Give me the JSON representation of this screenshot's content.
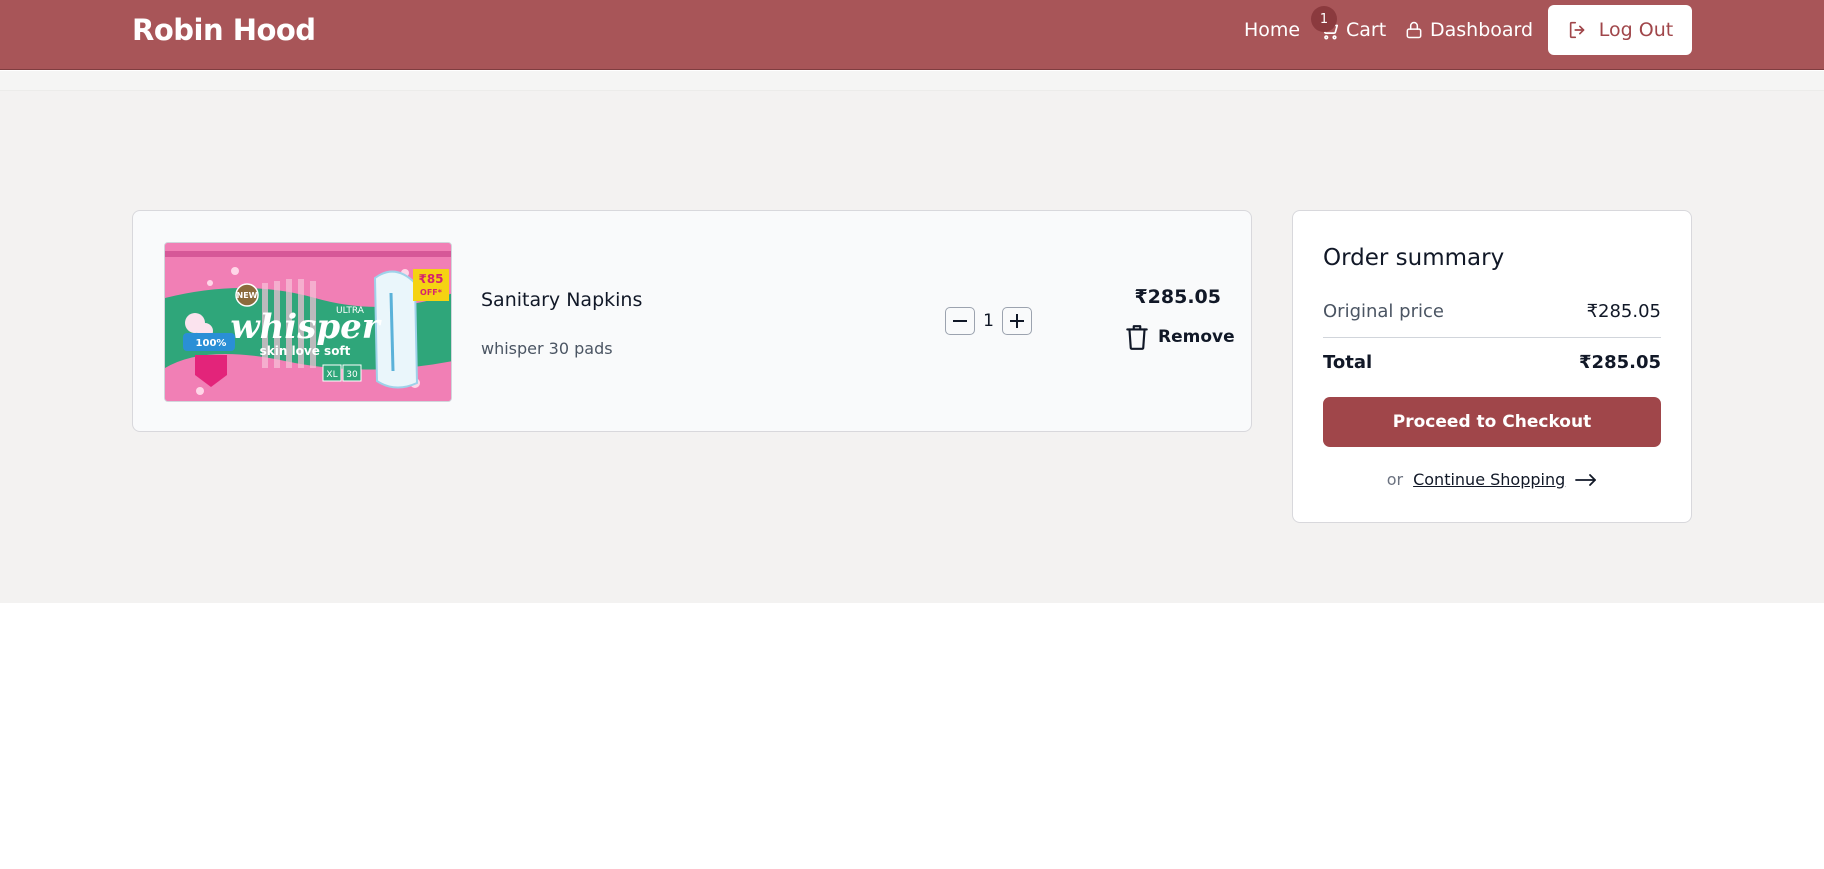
{
  "navbar": {
    "brand": "Robin Hood",
    "home": "Home",
    "cart": "Cart",
    "cart_count": "1",
    "dashboard": "Dashboard",
    "logout": "Log Out"
  },
  "cart": {
    "items": [
      {
        "name": "Sanitary Napkins",
        "description": "whisper 30 pads",
        "quantity": "1",
        "price": "₹285.05",
        "remove_label": "Remove",
        "image_text": {
          "badge": "NEW",
          "discount": "₹85",
          "discount_sub": "OFF*",
          "brand": "whisper",
          "brand_top": "ULTRA",
          "tagline": "skin love soft",
          "claim": "100%",
          "size": "XL",
          "count": "30"
        }
      }
    ]
  },
  "summary": {
    "title": "Order summary",
    "original_label": "Original price",
    "original_value": "₹285.05",
    "total_label": "Total",
    "total_value": "₹285.05",
    "checkout_label": "Proceed to Checkout",
    "or_text": "or",
    "continue_label": "Continue Shopping"
  },
  "colors": {
    "navbar": "#a85558",
    "accent": "#a0464a",
    "page_bg": "#f3f2f1"
  }
}
